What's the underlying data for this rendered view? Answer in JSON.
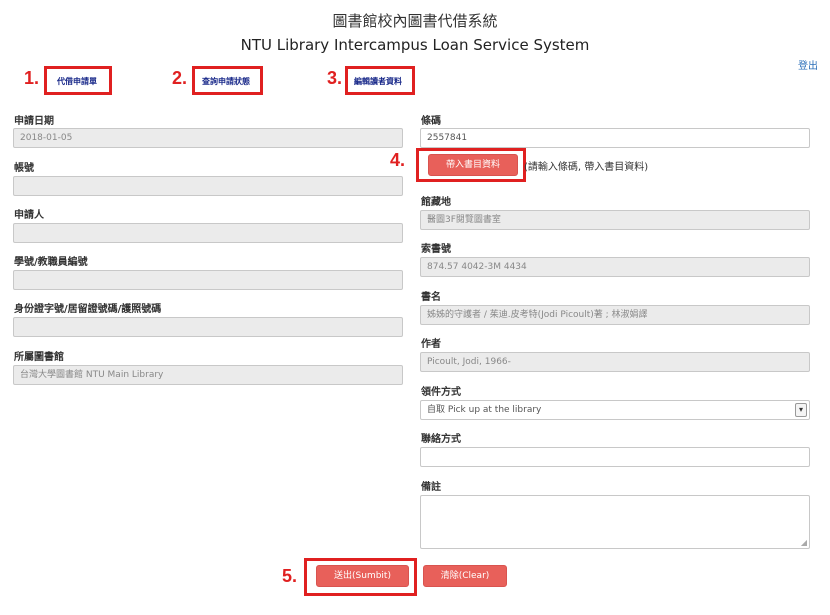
{
  "header": {
    "title_zh": "圖書館校內圖書代借系統",
    "title_en": "NTU Library Intercampus Loan Service System",
    "logout": "登出"
  },
  "steps": [
    "1.",
    "2.",
    "3.",
    "4.",
    "5."
  ],
  "nav": {
    "tab1": "代借申請單",
    "tab2": "查詢申請狀態",
    "tab3": "編輯讀者資料"
  },
  "left_form": {
    "apply_date_label": "申請日期",
    "apply_date_value": "2018-01-05",
    "account_label": "帳號",
    "account_value": "",
    "applicant_label": "申請人",
    "applicant_value": "",
    "student_id_label": "學號/教職員編號",
    "student_id_value": "",
    "id_no_label": "身份證字號/居留證號碼/護照號碼",
    "id_no_value": "",
    "library_label": "所屬圖書館",
    "library_value": "台灣大學圖書館 NTU Main Library"
  },
  "right_form": {
    "barcode_label": "條碼",
    "barcode_value": "2557841",
    "fetch_button": "帶入書目資料",
    "fetch_hint": "(請輸入條碼, 帶入書目資料)",
    "location_label": "館藏地",
    "location_value": "醫圖3F閱覽圖書室",
    "callno_label": "索書號",
    "callno_value": "874.57 4042-3M 4434",
    "title_label": "書名",
    "title_value": "姊姊的守護者 / 茱迪.皮考特(Jodi Picoult)著 ; 林淑娟譯",
    "author_label": "作者",
    "author_value": "Picoult, Jodi, 1966-",
    "pickup_label": "領件方式",
    "pickup_value": "自取 Pick up at the library",
    "contact_label": "聯絡方式",
    "contact_value": "",
    "note_label": "備註"
  },
  "actions": {
    "submit": "送出(Sumbit)",
    "clear": "清除(Clear)"
  },
  "colors": {
    "annotation_red": "#e02020",
    "button_red": "#e8605a",
    "link_blue": "#2a6eb8"
  }
}
